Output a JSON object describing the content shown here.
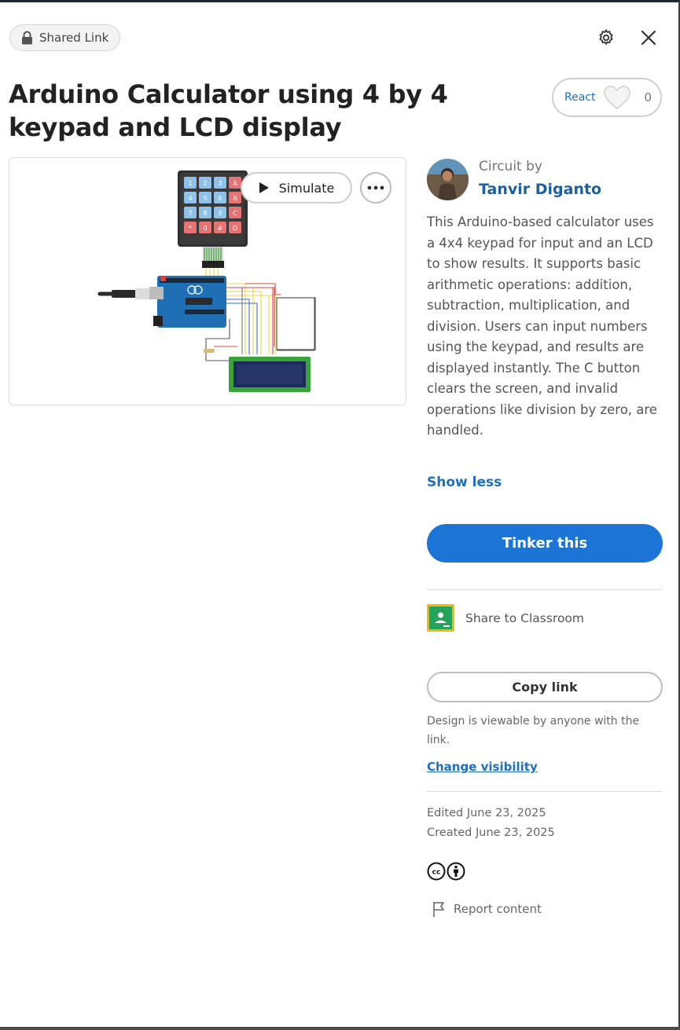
{
  "header": {
    "shared_label": "Shared Link",
    "lock_icon": "lock-icon",
    "settings_icon": "gear-icon",
    "close_icon": "close-icon"
  },
  "title": "Arduino Calculator using 4 by 4 keypad and LCD display",
  "react": {
    "label": "React",
    "count": "0",
    "icon": "heart-icon"
  },
  "preview": {
    "simulate_label": "Simulate",
    "play_icon": "play-icon",
    "more_icon": "more-horizontal-icon"
  },
  "author": {
    "by_label": "Circuit by",
    "name": "Tanvir Diganto"
  },
  "description": "This Arduino-based calculator uses a 4x4 keypad for input and an LCD to show results. It supports basic arithmetic operations: addition, subtraction, multiplication, and division. Users can input numbers using the keypad, and results are displayed instantly. The C button clears the screen, and invalid operations like division by zero, are handled.",
  "show_less": "Show less",
  "tinker_label": "Tinker this",
  "classroom_label": "Share to Classroom",
  "copy_link_label": "Copy link",
  "visibility_note": "Design is viewable by anyone with the link.",
  "change_visibility": "Change visibility",
  "edited": "Edited June 23, 2025",
  "created": "Created June 23, 2025",
  "report_label": "Report content",
  "keypad_keys": [
    "1",
    "2",
    "3",
    "A",
    "4",
    "5",
    "6",
    "B",
    "7",
    "8",
    "9",
    "C",
    "*",
    "0",
    "#",
    "D"
  ],
  "colors": {
    "accent": "#1b74d6",
    "link": "#1f6fbf",
    "author": "#1e5f9e"
  }
}
